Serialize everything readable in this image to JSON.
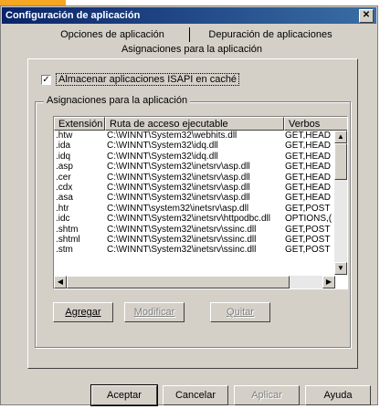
{
  "window": {
    "title": "Configuración de aplicación"
  },
  "tabs": [
    {
      "label": "Opciones de aplicación"
    },
    {
      "label": "Depuración de aplicaciones"
    },
    {
      "label": "Asignaciones para la aplicación"
    }
  ],
  "cache_checkbox": {
    "label": "Almacenar aplicaciones ISAPI en caché",
    "checked": true
  },
  "group": {
    "label": "Asignaciones para la aplicación",
    "columns": [
      "Extensión",
      "Ruta de acceso ejecutable",
      "Verbos"
    ],
    "rows": [
      [
        ".htw",
        "C:\\WINNT\\System32\\webhits.dll",
        "GET,HEAD"
      ],
      [
        ".ida",
        "C:\\WINNT\\System32\\idq.dll",
        "GET,HEAD"
      ],
      [
        ".idq",
        "C:\\WINNT\\System32\\idq.dll",
        "GET,HEAD"
      ],
      [
        ".asp",
        "C:\\WINNT\\System32\\inetsrv\\asp.dll",
        "GET,HEAD"
      ],
      [
        ".cer",
        "C:\\WINNT\\System32\\inetsrv\\asp.dll",
        "GET,HEAD"
      ],
      [
        ".cdx",
        "C:\\WINNT\\System32\\inetsrv\\asp.dll",
        "GET,HEAD"
      ],
      [
        ".asa",
        "C:\\WINNT\\System32\\inetsrv\\asp.dll",
        "GET,HEAD"
      ],
      [
        ".htr",
        "C:\\WINNT\\system32\\inetsrv\\asp.dll",
        "GET,POST"
      ],
      [
        ".idc",
        "C:\\WINNT\\System32\\inetsrv\\httpodbc.dll",
        "OPTIONS,("
      ],
      [
        ".shtm",
        "C:\\WINNT\\System32\\inetsrv\\ssinc.dll",
        "GET,POST"
      ],
      [
        ".shtml",
        "C:\\WINNT\\System32\\inetsrv\\ssinc.dll",
        "GET,POST"
      ],
      [
        ".stm",
        "C:\\WINNT\\System32\\inetsrv\\ssinc.dll",
        "GET,POST"
      ]
    ]
  },
  "list_buttons": {
    "add": "Agregar",
    "modify": "Modificar",
    "remove": "Quitar"
  },
  "footer_buttons": {
    "ok": "Aceptar",
    "cancel": "Cancelar",
    "apply": "Aplicar",
    "help": "Ayuda"
  },
  "colors": {
    "title_start": "#0a246a",
    "title_end": "#3a6ea5",
    "face": "#d4d0c8",
    "accent": "#f5a623"
  }
}
